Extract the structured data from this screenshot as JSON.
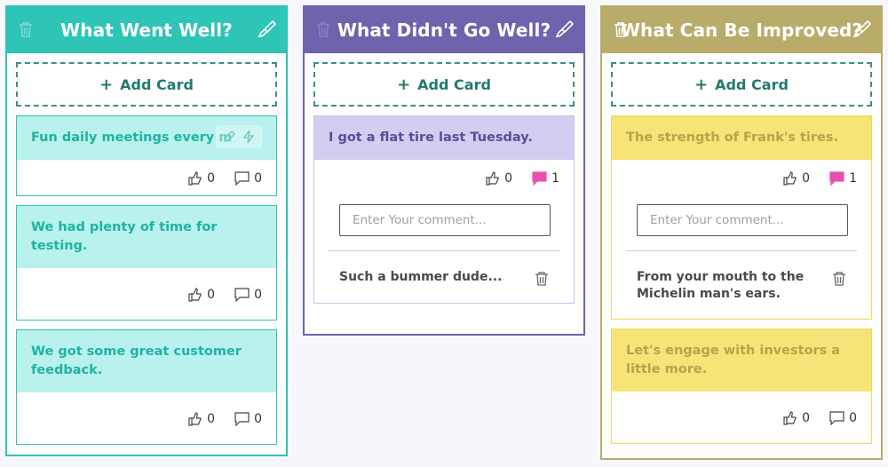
{
  "columns": [
    {
      "title": "What Went Well?",
      "add_card_label": "Add Card",
      "cards": [
        {
          "text": "Fun daily meetings every m",
          "likes": "0",
          "comments": "0"
        },
        {
          "text": "We had plenty of time for testing.",
          "likes": "0",
          "comments": "0"
        },
        {
          "text": "We got some great customer feedback.",
          "likes": "0",
          "comments": "0"
        }
      ]
    },
    {
      "title": "What Didn't Go Well?",
      "add_card_label": "Add Card",
      "cards": [
        {
          "text": "I got a flat tire last Tuesday.",
          "likes": "0",
          "comments": "1",
          "comment_placeholder": "Enter Your comment...",
          "comment_list": [
            {
              "text": "Such a bummer dude..."
            }
          ]
        }
      ]
    },
    {
      "title": "What Can Be Improved?",
      "add_card_label": "Add Card",
      "cards": [
        {
          "text": "The strength of Frank's tires.",
          "likes": "0",
          "comments": "1",
          "comment_placeholder": "Enter Your comment...",
          "comment_list": [
            {
              "text": "From your mouth to the Michelin man's ears."
            }
          ]
        },
        {
          "text": "Let's engage with investors a little more.",
          "likes": "0",
          "comments": "0"
        }
      ]
    }
  ],
  "colors": {
    "col1": "#2ec4b6",
    "col1_card": "#b9f1ec",
    "col1_text": "#1fb3a4",
    "col2": "#6f63ad",
    "col2_card": "#d4cdef",
    "col2_text": "#5a4d9b",
    "col3": "#b9ac6a",
    "col3_card": "#f7e476",
    "col3_text": "#b3a64a",
    "comment_active": "#e94fb0",
    "add_card": "#237a6e"
  }
}
